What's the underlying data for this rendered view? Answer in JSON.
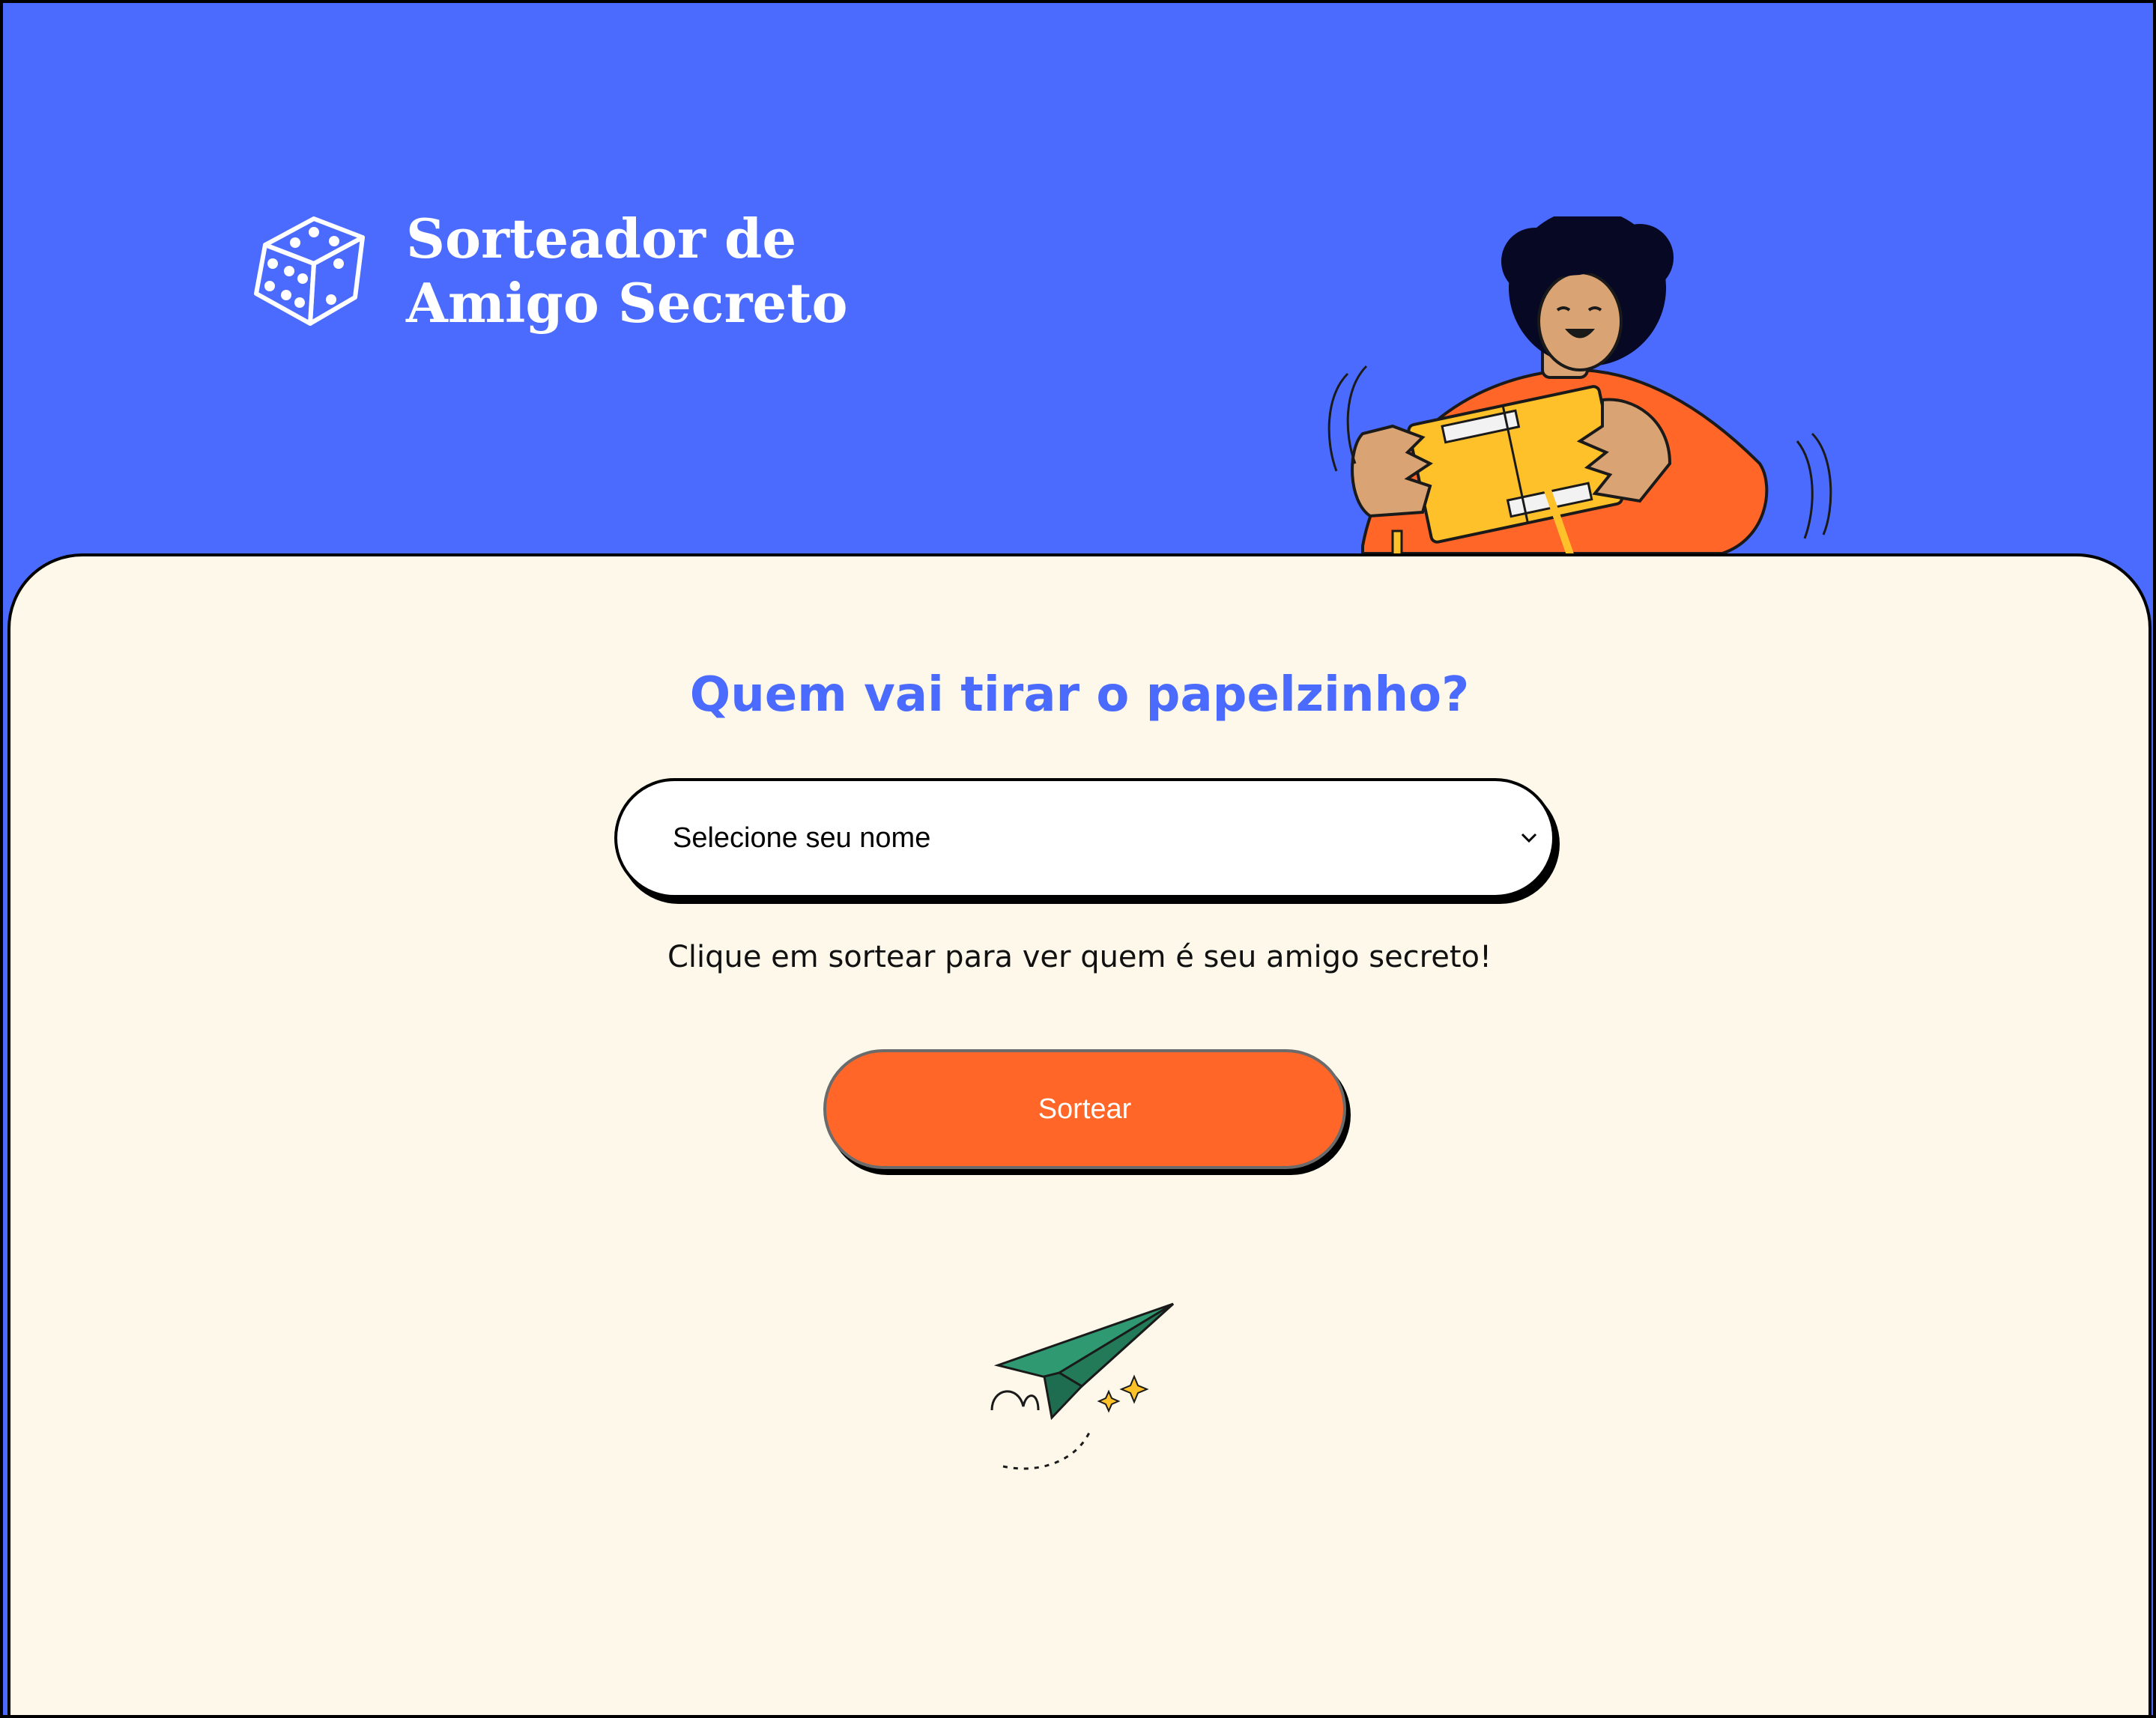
{
  "header": {
    "logo_line1": "Sorteador de",
    "logo_line2": "Amigo Secreto"
  },
  "main": {
    "title": "Quem vai tirar o papelzinho?",
    "name_select": {
      "selected_value": "Selecione seu nome"
    },
    "hint": "Clique em sortear para ver quem é seu amigo secreto!",
    "draw_button_label": "Sortear"
  },
  "colors": {
    "header_background": "#4b6bfe",
    "content_background": "#fdf8e9",
    "title_color": "#4b6bfe",
    "button_background": "#ff6628",
    "plane_green": "#2f9a72"
  },
  "icons": {
    "logo": "dice-icon",
    "select": "chevron-down-icon",
    "hero": "person-with-gift-illustration",
    "footer": "paper-plane-illustration"
  }
}
